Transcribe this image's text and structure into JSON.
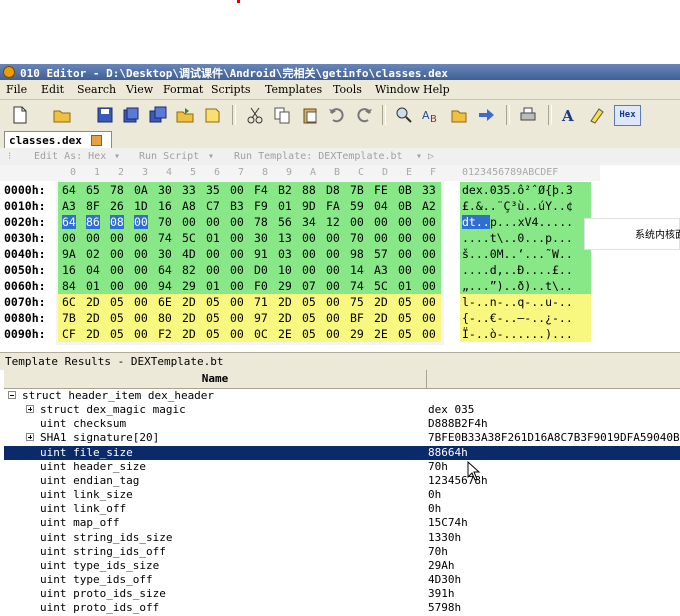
{
  "window": {
    "title": "010 Editor - D:\\Desktop\\调试课件\\Android\\完相关\\getinfo\\classes.dex"
  },
  "menu": [
    "File",
    "Edit",
    "Search",
    "View",
    "Format",
    "Scripts",
    "Templates",
    "Tools",
    "Window",
    "Help"
  ],
  "toolbar": {
    "hex_label": "Hex"
  },
  "tab": {
    "label": "classes.dex"
  },
  "hexbar": {
    "edit_as": "Edit As: Hex",
    "run_script": "Run Script",
    "run_template": "Run Template: DEXTemplate.bt"
  },
  "column_header": {
    "hex_cols": [
      "0",
      "1",
      "2",
      "3",
      "4",
      "5",
      "6",
      "7",
      "8",
      "9",
      "A",
      "B",
      "C",
      "D",
      "E",
      "F"
    ],
    "ascii_cols": "0123456789ABCDEF"
  },
  "hex_rows": [
    {
      "addr": "0000h:",
      "bytes": [
        "64",
        "65",
        "78",
        "0A",
        "30",
        "33",
        "35",
        "00",
        "F4",
        "B2",
        "88",
        "D8",
        "7B",
        "FE",
        "0B",
        "33"
      ],
      "ascii": "dex.035.ô²ˆØ{þ.3"
    },
    {
      "addr": "0010h:",
      "bytes": [
        "A3",
        "8F",
        "26",
        "1D",
        "16",
        "A8",
        "C7",
        "B3",
        "F9",
        "01",
        "9D",
        "FA",
        "59",
        "04",
        "0B",
        "A2"
      ],
      "ascii": "£.&..¨Ç³ù..úY..¢"
    },
    {
      "addr": "0020h:",
      "bytes": [
        "64",
        "86",
        "08",
        "00",
        "70",
        "00",
        "00",
        "00",
        "78",
        "56",
        "34",
        "12",
        "00",
        "00",
        "00",
        "00"
      ],
      "ascii": "dt..p...xV4....."
    },
    {
      "addr": "0030h:",
      "bytes": [
        "00",
        "00",
        "00",
        "00",
        "74",
        "5C",
        "01",
        "00",
        "30",
        "13",
        "00",
        "00",
        "70",
        "00",
        "00",
        "00"
      ],
      "ascii": "....t\\..0...p..."
    },
    {
      "addr": "0040h:",
      "bytes": [
        "9A",
        "02",
        "00",
        "00",
        "30",
        "4D",
        "00",
        "00",
        "91",
        "03",
        "00",
        "00",
        "98",
        "57",
        "00",
        "00"
      ],
      "ascii": "š...0M..‘...˜W.."
    },
    {
      "addr": "0050h:",
      "bytes": [
        "16",
        "04",
        "00",
        "00",
        "64",
        "82",
        "00",
        "00",
        "D0",
        "10",
        "00",
        "00",
        "14",
        "A3",
        "00",
        "00"
      ],
      "ascii": "....d‚..Ð....£.."
    },
    {
      "addr": "0060h:",
      "bytes": [
        "84",
        "01",
        "00",
        "00",
        "94",
        "29",
        "01",
        "00",
        "F0",
        "29",
        "07",
        "00",
        "74",
        "5C",
        "01",
        "00"
      ],
      "ascii": "„...”)..ð)..t\\.."
    },
    {
      "addr": "0070h:",
      "bytes": [
        "6C",
        "2D",
        "05",
        "00",
        "6E",
        "2D",
        "05",
        "00",
        "71",
        "2D",
        "05",
        "00",
        "75",
        "2D",
        "05",
        "00"
      ],
      "ascii": "l-..n-..q-..u-.."
    },
    {
      "addr": "0080h:",
      "bytes": [
        "7B",
        "2D",
        "05",
        "00",
        "80",
        "2D",
        "05",
        "00",
        "97",
        "2D",
        "05",
        "00",
        "BF",
        "2D",
        "05",
        "00"
      ],
      "ascii": "{-..€-..—-..¿-.."
    },
    {
      "addr": "0090h:",
      "bytes": [
        "CF",
        "2D",
        "05",
        "00",
        "F2",
        "2D",
        "05",
        "00",
        "0C",
        "2E",
        "05",
        "00",
        "29",
        "2E",
        "05",
        "00"
      ],
      "ascii": "Ï-..ò-......)..."
    }
  ],
  "overlay": {
    "text": "系统内核面"
  },
  "template": {
    "bar_title": "Template Results - DEXTemplate.bt",
    "col_name": "Name",
    "rows": [
      {
        "name": "struct header_item dex_header",
        "value": ""
      },
      {
        "name": "struct dex_magic magic",
        "value": "dex 035"
      },
      {
        "name": "uint checksum",
        "value": "D888B2F4h"
      },
      {
        "name": "SHA1 signature[20]",
        "value": "7BFE0B33A38F261D16A8C7B3F9019DFA59040BA2"
      },
      {
        "name": "uint file_size",
        "value": "88664h"
      },
      {
        "name": "uint header_size",
        "value": "70h"
      },
      {
        "name": "uint endian_tag",
        "value": "12345678h"
      },
      {
        "name": "uint link_size",
        "value": "0h"
      },
      {
        "name": "uint link_off",
        "value": "0h"
      },
      {
        "name": "uint map_off",
        "value": "15C74h"
      },
      {
        "name": "uint string_ids_size",
        "value": "1330h"
      },
      {
        "name": "uint string_ids_off",
        "value": "70h"
      },
      {
        "name": "uint type_ids_size",
        "value": "29Ah"
      },
      {
        "name": "uint type_ids_off",
        "value": "4D30h"
      },
      {
        "name": "uint proto_ids_size",
        "value": "391h"
      },
      {
        "name": "uint proto_ids_off",
        "value": "5798h"
      }
    ]
  },
  "colors": {
    "struct_green": "#88e888",
    "struct_yellow": "#f8f880",
    "selection_blue": "#2f6fd0",
    "row_selected": "#0a2a6a"
  }
}
